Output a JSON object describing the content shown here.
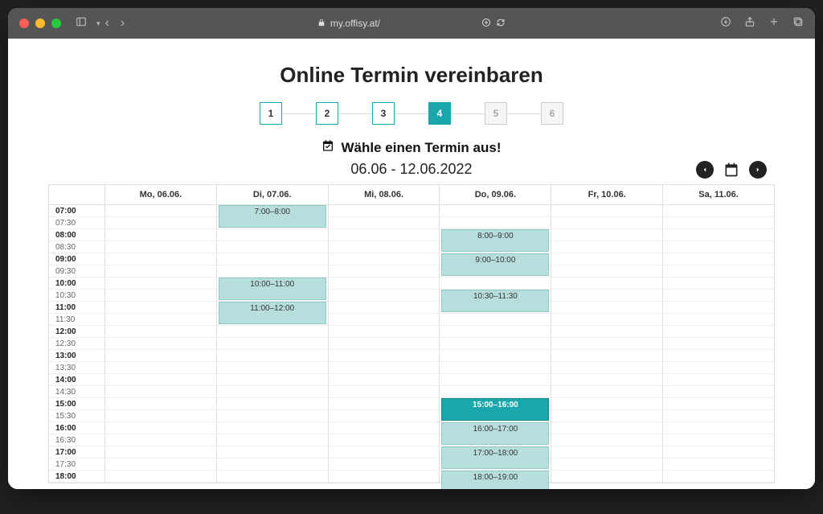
{
  "browser": {
    "url": "my.offisy.at/"
  },
  "page": {
    "title": "Online Termin vereinbaren",
    "choose_label": "Wähle einen Termin aus!",
    "date_range": "06.06 - 12.06.2022"
  },
  "steps": [
    {
      "label": "1",
      "state": "normal"
    },
    {
      "label": "2",
      "state": "normal"
    },
    {
      "label": "3",
      "state": "normal"
    },
    {
      "label": "4",
      "state": "active"
    },
    {
      "label": "5",
      "state": "disabled"
    },
    {
      "label": "6",
      "state": "disabled"
    }
  ],
  "calendar": {
    "days": [
      {
        "label": "Mo, 06.06."
      },
      {
        "label": "Di, 07.06."
      },
      {
        "label": "Mi, 08.06."
      },
      {
        "label": "Do, 09.06."
      },
      {
        "label": "Fr, 10.06."
      },
      {
        "label": "Sa, 11.06."
      }
    ],
    "time_slots": [
      "07:00",
      "07:30",
      "08:00",
      "08:30",
      "09:00",
      "09:30",
      "10:00",
      "10:30",
      "11:00",
      "11:30",
      "12:00",
      "12:30",
      "13:00",
      "13:30",
      "14:00",
      "14:30",
      "15:00",
      "15:30",
      "16:00",
      "16:30",
      "17:00",
      "17:30",
      "18:00"
    ],
    "events": [
      {
        "day": 1,
        "start": "07:00",
        "end": "08:00",
        "label": "7:00–8:00",
        "selected": false
      },
      {
        "day": 1,
        "start": "10:00",
        "end": "11:00",
        "label": "10:00–11:00",
        "selected": false
      },
      {
        "day": 1,
        "start": "11:00",
        "end": "12:00",
        "label": "11:00–12:00",
        "selected": false
      },
      {
        "day": 3,
        "start": "08:00",
        "end": "09:00",
        "label": "8:00–9:00",
        "selected": false
      },
      {
        "day": 3,
        "start": "09:00",
        "end": "10:00",
        "label": "9:00–10:00",
        "selected": false
      },
      {
        "day": 3,
        "start": "10:30",
        "end": "11:30",
        "label": "10:30–11:30",
        "selected": false
      },
      {
        "day": 3,
        "start": "15:00",
        "end": "16:00",
        "label": "15:00–16:00",
        "selected": true
      },
      {
        "day": 3,
        "start": "16:00",
        "end": "17:00",
        "label": "16:00–17:00",
        "selected": false
      },
      {
        "day": 3,
        "start": "17:00",
        "end": "18:00",
        "label": "17:00–18:00",
        "selected": false
      },
      {
        "day": 3,
        "start": "18:00",
        "end": "19:00",
        "label": "18:00–19:00",
        "selected": false
      }
    ]
  }
}
